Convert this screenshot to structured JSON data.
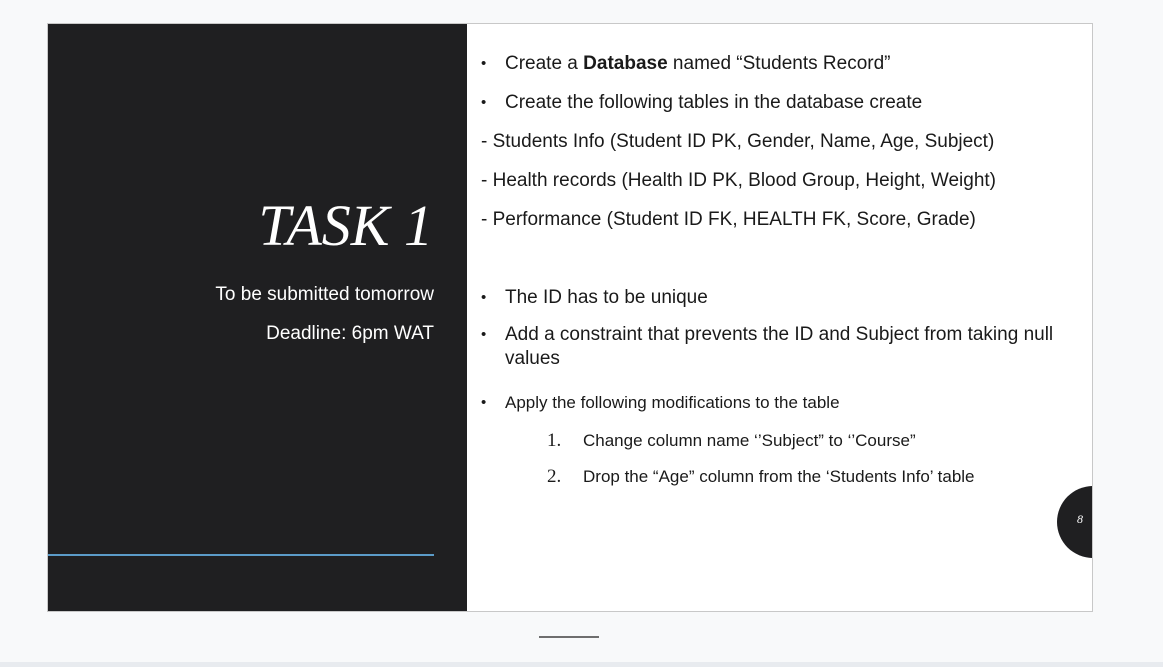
{
  "slide": {
    "title": "TASK 1",
    "subtitle": "To be submitted tomorrow",
    "deadline": "Deadline: 6pm WAT",
    "page_number": "8",
    "bullet_glyph": "•",
    "colors": {
      "left_panel": "#1f1f21",
      "accent_line": "#5b9bc8",
      "text": "#1a1a1a"
    }
  },
  "content": {
    "bullet1": {
      "prefix": "Create a ",
      "bold": "Database",
      "suffix": " named “Students Record”"
    },
    "bullet2": "Create the following tables in the database create",
    "tables": [
      "- Students Info (Student ID PK, Gender, Name, Age, Subject)",
      "- Health records (Health ID PK, Blood Group, Height, Weight)",
      "- Performance (Student ID FK, HEALTH FK,  Score, Grade)"
    ],
    "bullet3": "The ID has to be unique",
    "bullet4": "Add a constraint that prevents the ID and Subject from taking null values",
    "bullet5": "Apply the following modifications to the table",
    "modifications": [
      {
        "num": "1.",
        "text": "Change column name ‘’Subject” to ‘’Course”"
      },
      {
        "num": "2.",
        "text": "Drop the “Age” column from the ‘Students Info’ table"
      }
    ]
  }
}
